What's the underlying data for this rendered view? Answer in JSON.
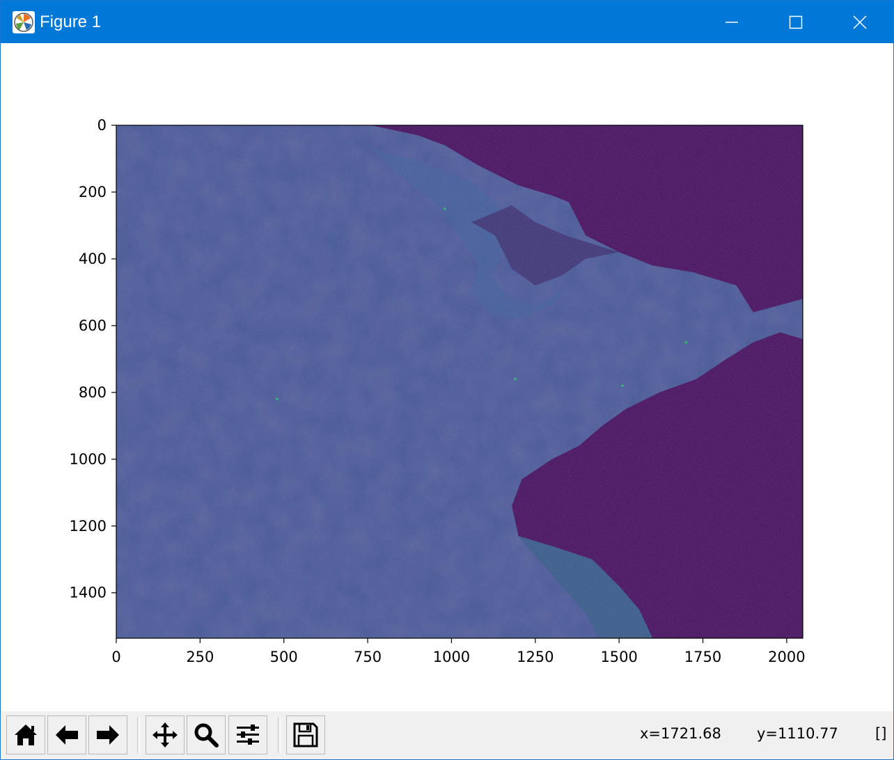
{
  "window": {
    "title": "Figure 1",
    "title_bar_color": "#0078d7"
  },
  "title_buttons": [
    "minimize-icon",
    "maximize-icon",
    "close-icon"
  ],
  "chart_data": {
    "type": "heatmap",
    "description_kind": "image",
    "colormap": "viridis",
    "image_size": {
      "width": 2048,
      "height": 1536
    },
    "xlim": [
      0,
      2048
    ],
    "ylim": [
      1536,
      0
    ],
    "x_ticks": [
      0,
      250,
      500,
      750,
      1000,
      1250,
      1500,
      1750,
      2000
    ],
    "y_ticks": [
      0,
      200,
      400,
      600,
      800,
      1000,
      1200,
      1400
    ],
    "x_tick_labels": [
      "0",
      "250",
      "500",
      "750",
      "1000",
      "1250",
      "1500",
      "1750",
      "2000"
    ],
    "y_tick_labels": [
      "0",
      "200",
      "400",
      "600",
      "800",
      "1000",
      "1200",
      "1400"
    ],
    "title": "",
    "xlabel": "",
    "ylabel": "",
    "colors": {
      "land": "#3b4b8c",
      "sea_dark": "#440154",
      "sea_mid": "#3a2a6e",
      "turbid_water": "#31688e",
      "bright_pixel": "#35b779"
    }
  },
  "toolbar": {
    "buttons": [
      {
        "name": "home-button",
        "icon": "home-icon"
      },
      {
        "name": "back-button",
        "icon": "arrow-left-icon"
      },
      {
        "name": "forward-button",
        "icon": "arrow-right-icon"
      },
      {
        "name": "pan-button",
        "icon": "move-icon"
      },
      {
        "name": "zoom-button",
        "icon": "magnifier-icon"
      },
      {
        "name": "configure-subplots-button",
        "icon": "sliders-icon"
      },
      {
        "name": "save-button",
        "icon": "floppy-disk-icon"
      }
    ],
    "coord_x": "x=1721.68",
    "coord_y": "y=1110.77",
    "coord_value": "[]"
  }
}
